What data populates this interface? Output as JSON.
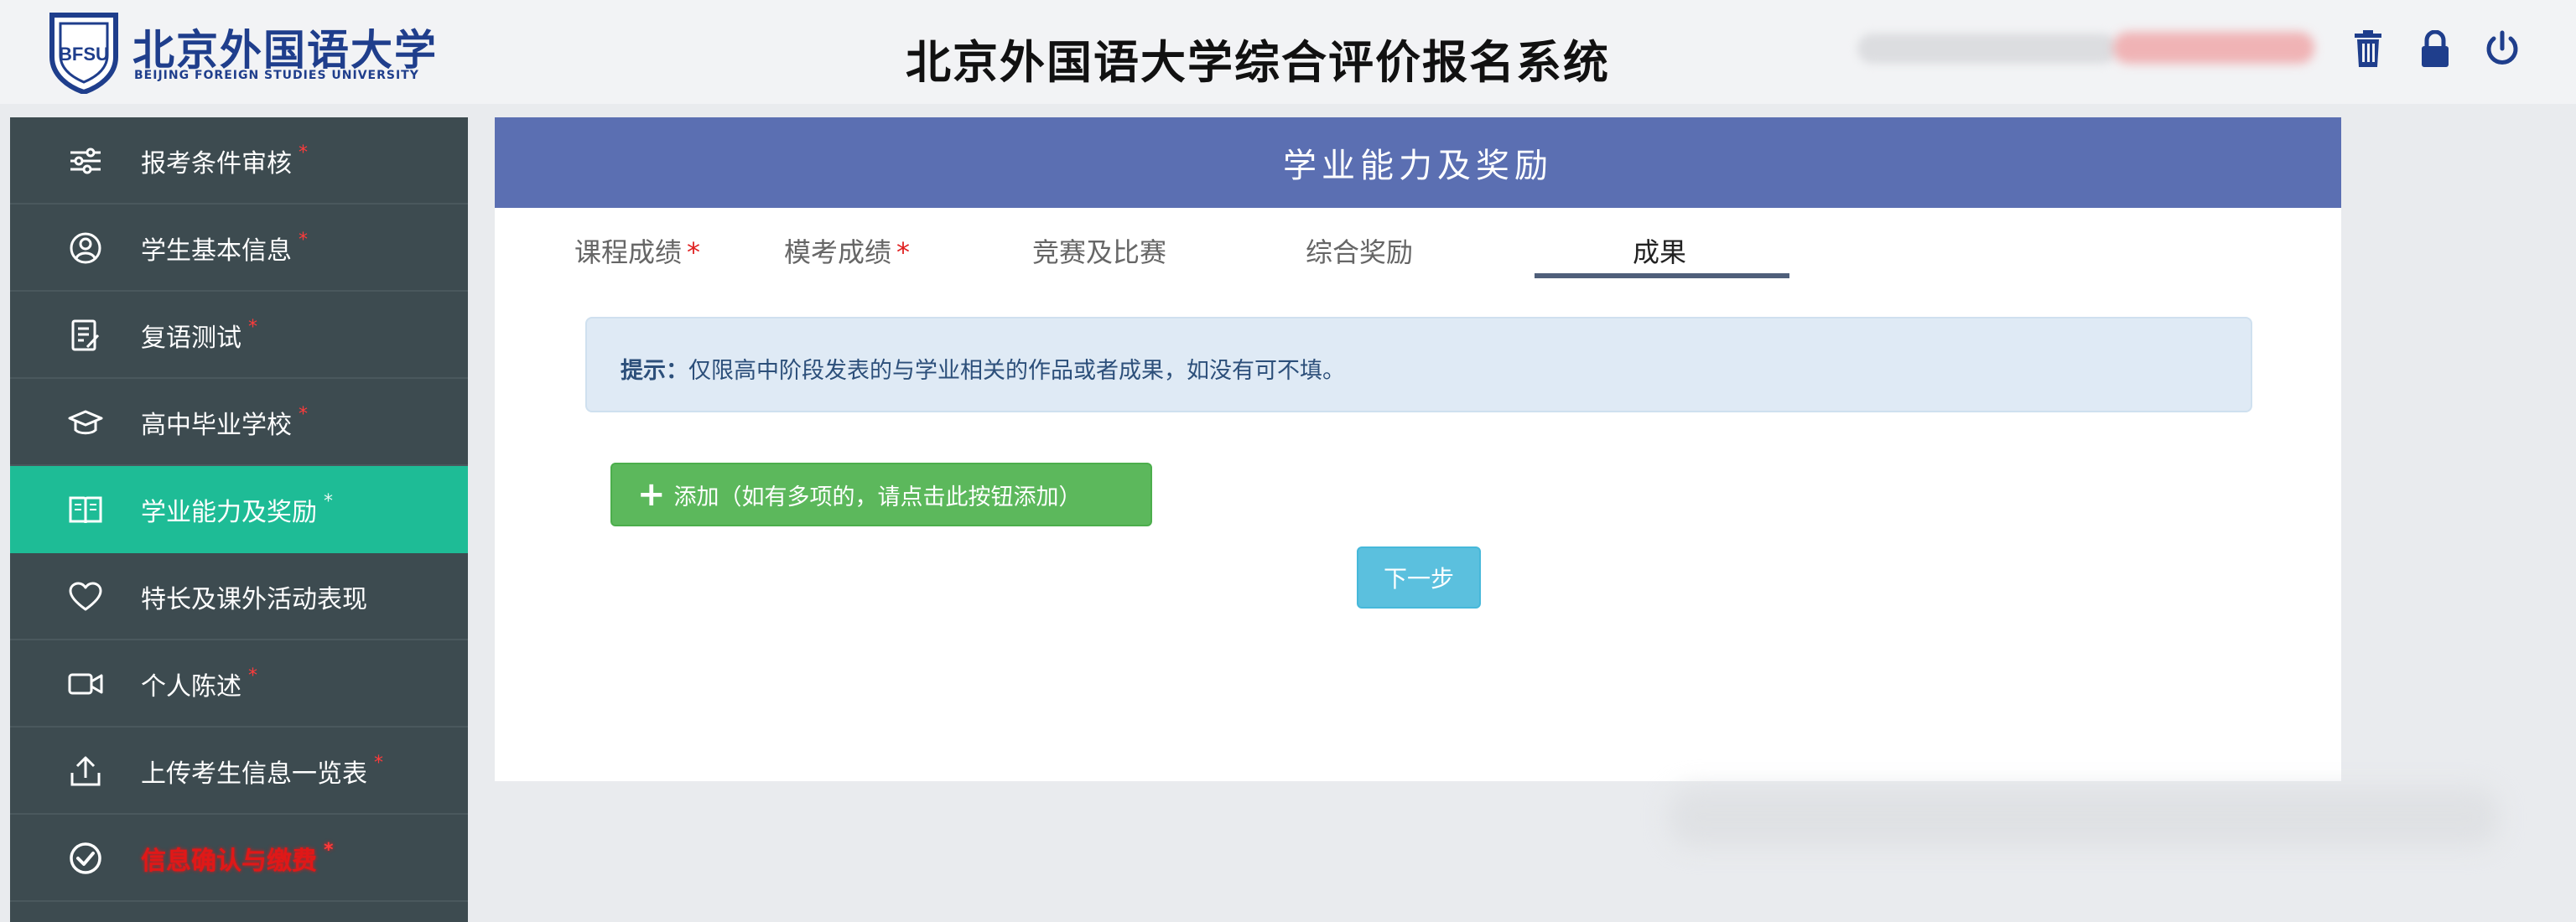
{
  "header": {
    "logo_cn": "北京外国语大学",
    "logo_en": "BEIJING FOREIGN STUDIES UNIVERSITY",
    "title": "北京外国语大学综合评价报名系统",
    "icons": [
      "trash-icon",
      "lock-icon",
      "power-icon"
    ]
  },
  "sidebar": {
    "items": [
      {
        "label": "报考条件审核",
        "icon": "sliders-icon",
        "required": "*"
      },
      {
        "label": "学生基本信息",
        "icon": "user-circle-icon",
        "required": "*"
      },
      {
        "label": "复语测试",
        "icon": "edit-doc-icon",
        "required": "*"
      },
      {
        "label": "高中毕业学校",
        "icon": "graduation-cap-icon",
        "required": "*"
      },
      {
        "label": "学业能力及奖励",
        "icon": "book-icon",
        "required": "*"
      },
      {
        "label": "特长及课外活动表现",
        "icon": "heart-icon",
        "required": ""
      },
      {
        "label": "个人陈述",
        "icon": "video-icon",
        "required": "*"
      },
      {
        "label": "上传考生信息一览表",
        "icon": "upload-icon",
        "required": "*"
      },
      {
        "label": "信息确认与缴费",
        "icon": "check-circle-icon",
        "required": "*"
      }
    ]
  },
  "panel": {
    "title": "学业能力及奖励",
    "tabs": [
      {
        "label": "课程成绩",
        "star": "*"
      },
      {
        "label": "模考成绩",
        "star": "*"
      },
      {
        "label": "竞赛及比赛",
        "star": ""
      },
      {
        "label": "综合奖励",
        "star": ""
      },
      {
        "label": "成果",
        "star": ""
      }
    ],
    "active_tab": "成果",
    "tip_prefix": "提示：",
    "tip_text": "仅限高中阶段发表的与学业相关的作品或者成果，如没有可不填。",
    "add_button": "添加（如有多项的，请点击此按钮添加）",
    "next_button": "下一步"
  },
  "colors": {
    "sidebar_bg": "#3d4b50",
    "sidebar_active": "#1ebc96",
    "panel_head": "#5b6fb2",
    "add_green": "#5cb85c",
    "next_blue": "#5bc0de",
    "header_icon": "#1f3e8c"
  }
}
